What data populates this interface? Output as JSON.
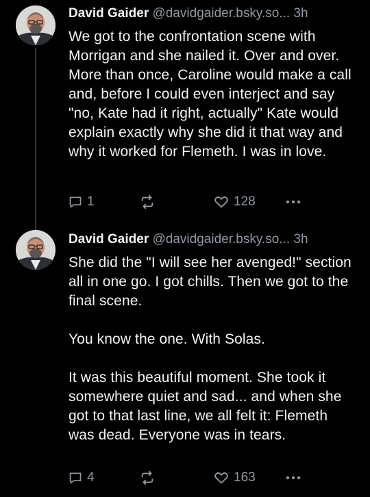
{
  "posts": [
    {
      "author_name": "David Gaider",
      "handle": "@davidgaider.bsky.so...",
      "time": "3h",
      "text": "We got to the confrontation scene with Morrigan and she nailed it. Over and over. More than once, Caroline would make a call and, before I could even interject and say \"no, Kate had it right, actually\" Kate would explain exactly why she did it that way and why it worked for Flemeth. I was in love.",
      "reply_count": "1",
      "like_count": "128"
    },
    {
      "author_name": "David Gaider",
      "handle": "@davidgaider.bsky.so...",
      "time": "3h",
      "text": "She did the \"I will see her avenged!\" section all in one go. I got chills. Then we got to the final scene.\n\nYou know the one. With Solas.\n\nIt was this beautiful moment. She took it somewhere quiet and sad... and when she got to that last line, we all felt it: Flemeth was dead. Everyone was in tears.",
      "reply_count": "4",
      "like_count": "163"
    }
  ],
  "icons": {
    "reply": "reply-icon",
    "repost": "repost-icon",
    "like": "heart-icon",
    "more": "more-icon"
  },
  "colors": {
    "background": "#000000",
    "text": "#f1f3f5",
    "muted": "#8f9aa6",
    "thread_line": "#2e3843"
  }
}
